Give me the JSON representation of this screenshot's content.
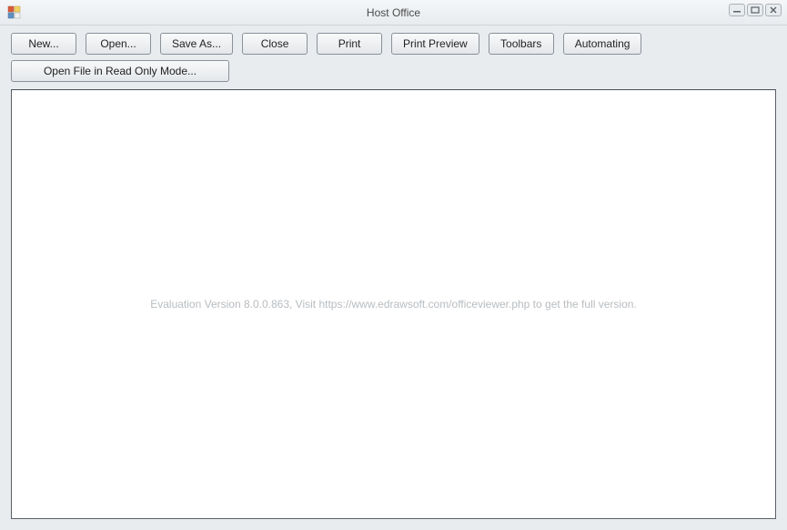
{
  "window": {
    "title": "Host Office"
  },
  "toolbar": {
    "row1": {
      "new_label": "New...",
      "open_label": "Open...",
      "save_as_label": "Save As...",
      "close_label": "Close",
      "print_label": "Print",
      "print_preview_label": "Print Preview",
      "toolbars_label": "Toolbars",
      "automating_label": "Automating"
    },
    "row2": {
      "open_readonly_label": "Open File in Read Only Mode..."
    }
  },
  "main": {
    "watermark_text": "Evaluation Version 8.0.0.863, Visit https://www.edrawsoft.com/officeviewer.php to get the full version."
  }
}
